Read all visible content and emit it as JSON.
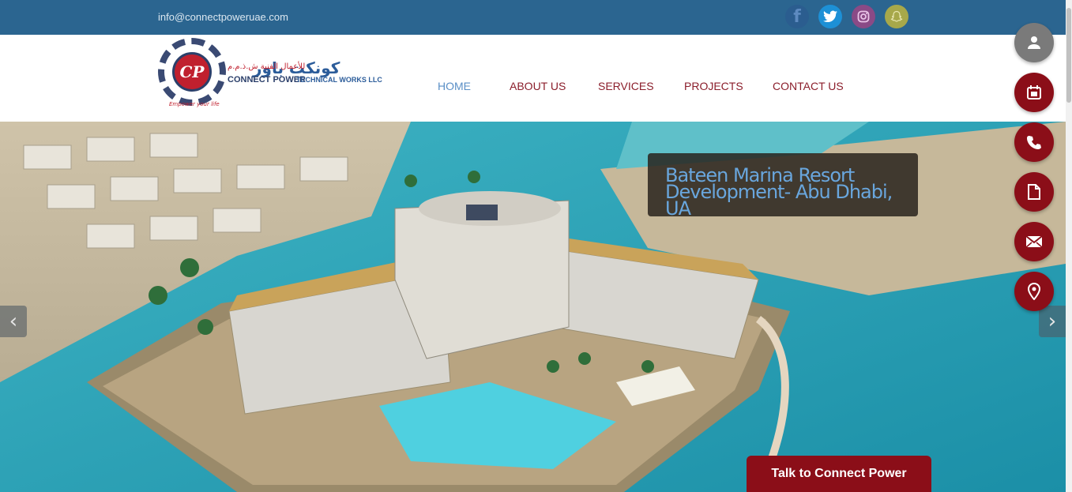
{
  "topbar": {
    "email": "info@connectpoweruae.com",
    "social": [
      {
        "icon": "facebook-icon",
        "glyph": "f"
      },
      {
        "icon": "twitter-icon",
        "glyph": "🐦"
      },
      {
        "icon": "instagram-icon",
        "glyph": "◎"
      },
      {
        "icon": "snapchat-icon",
        "glyph": "👻"
      }
    ]
  },
  "logo": {
    "mark": "CP",
    "arabic_name": "كونكت باور",
    "arabic_sub": "للأعمال الفنية ش.ذ.م.م",
    "english_line1": "CONNECT POWER",
    "english_line2": "TECHNICAL WORKS LLC",
    "tagline": "Empower your life"
  },
  "nav": {
    "items": [
      "HOME",
      "ABOUT US",
      "SERVICES",
      "PROJECTS",
      "CONTACT US"
    ],
    "active": "HOME"
  },
  "hero": {
    "caption": "Bateen Marina Resort Development- Abu Dhabi, UA",
    "prev_arrow": "‹",
    "next_arrow": "›",
    "cta": "Talk to Connect Power"
  },
  "fabs": [
    {
      "icon": "user-icon",
      "color": "#7a7a7a"
    },
    {
      "icon": "calendar-icon",
      "color": "#8b0e18"
    },
    {
      "icon": "phone-icon",
      "color": "#8b0e18"
    },
    {
      "icon": "document-icon",
      "color": "#8b0e18"
    },
    {
      "icon": "mail-icon",
      "color": "#8b0e18"
    },
    {
      "icon": "map-pin-icon",
      "color": "#8b0e18"
    }
  ],
  "colors": {
    "topbar": "#2b6590",
    "brand_red": "#8b0e18",
    "nav_text": "#8b1e2b",
    "nav_active": "#5a8fc6"
  }
}
